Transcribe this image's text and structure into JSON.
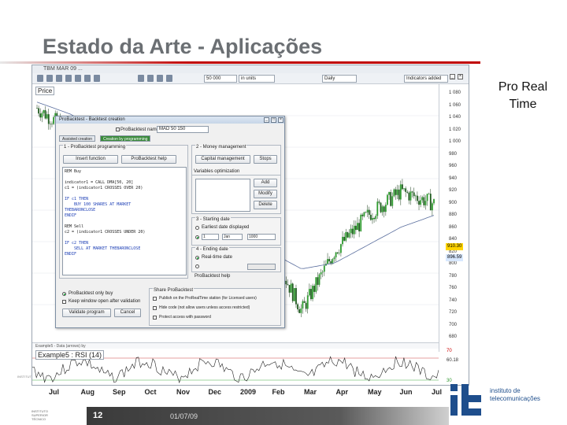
{
  "slide": {
    "title": "Estado da Arte - Aplicações",
    "side_caption_line1": "Pro Real",
    "side_caption_line2": "Time",
    "page_number": "12",
    "date": "01/07/09",
    "logo_text_line1": "instituto de",
    "logo_text_line2": "telecomunicações",
    "logo_mark": "it",
    "footer_left_lines": [
      "INSTITUTO",
      "SUPERIOR",
      "TÉCNICO"
    ],
    "instituto_small": "INSTITUT"
  },
  "app": {
    "window_title": "TBM MAR 09 ...",
    "toolbar": {
      "period_value": "50 000",
      "unit_value": "in units",
      "interval_value": "Daily",
      "indicator_value": "Indicators added"
    },
    "price_label": "Price",
    "price_ticks": [
      "1 080",
      "1 060",
      "1 040",
      "1 020",
      "1 000",
      "980",
      "960",
      "940",
      "920",
      "900",
      "880",
      "860",
      "840",
      "820",
      "800",
      "780",
      "760",
      "740",
      "720",
      "700",
      "680"
    ],
    "price_marker": "910.30",
    "price_marker2": "896.59",
    "rsi_header": "Example5 - Data (arrows) by",
    "rsi_label": "Example5 : RSI (14)",
    "rsi_ticks": [
      "70",
      "60.18",
      "30"
    ],
    "months": [
      "Jul",
      "Aug",
      "Sep",
      "Oct",
      "Nov",
      "Dec",
      "2009",
      "Feb",
      "Mar",
      "Apr",
      "May",
      "Jun",
      "Jul"
    ]
  },
  "dialog": {
    "title": "ProBacktest - Backtest creation",
    "name_label": "ProBacktest name",
    "name_value": "MAD 50 150",
    "tabs": [
      "Assisted creation",
      "Creation by programming"
    ],
    "section1_title": "1 - ProBacktest programming",
    "insert_function": "Insert function",
    "probacktest_help": "ProBacktest help",
    "code_lines": [
      {
        "text": "REM Buy",
        "kw": false
      },
      {
        "text": "",
        "kw": false
      },
      {
        "text": "indicator1 = CALL DMA[50, 20]",
        "kw": false
      },
      {
        "text": "c1 = (indicator1 CROSSES OVER 20)",
        "kw": false
      },
      {
        "text": "",
        "kw": false
      },
      {
        "text": "IF c1 THEN",
        "kw": true
      },
      {
        "text": "    BUY 100 SHARES AT MARKET",
        "kw": true
      },
      {
        "text": "THEBARONCLOSE",
        "kw": true
      },
      {
        "text": "ENDIF",
        "kw": true
      },
      {
        "text": "",
        "kw": false
      },
      {
        "text": "REM Sell",
        "kw": false
      },
      {
        "text": "c2 = (indicator1 CROSSES UNDER 20)",
        "kw": false
      },
      {
        "text": "",
        "kw": false
      },
      {
        "text": "IF c2 THEN",
        "kw": true
      },
      {
        "text": "    SELL AT MARKET THEBARONCLOSE",
        "kw": true
      },
      {
        "text": "ENDIF",
        "kw": true
      }
    ],
    "section2_title": "2 - Money management",
    "capital_management": "Capital management",
    "stops": "Stops",
    "variables_title": "Variables optimization",
    "add": "Add",
    "modify": "Modify",
    "delete": "Delete",
    "section3_title": "3 - Starting date",
    "start_option": "Earliest date displayed",
    "start_day": "1",
    "start_month": "Jan",
    "start_year": "1000",
    "section4_title": "4 - Ending date",
    "end_option": "Real-time date",
    "probacktest_help2": "ProBacktest help",
    "probuilder_option": "ProBacktest only buy",
    "alert_option": "Keep window open after validation",
    "validate": "Validate program",
    "cancel": "Cancel",
    "share_title": "Share ProBacktest",
    "share_opt1": "Publish on the ProRealTime station (for Licensed users)",
    "share_opt2": "Hide code (not allow users unless access restricted)",
    "share_opt3": "Protect access with password"
  },
  "chart_data": {
    "type": "candlestick",
    "x": [
      "Jul",
      "Aug",
      "Sep",
      "Oct",
      "Nov",
      "Dec",
      "2009",
      "Feb",
      "Mar",
      "Apr",
      "May",
      "Jun",
      "Jul"
    ],
    "series": [
      {
        "values": [
          1060,
          1020,
          1000,
          960,
          900,
          880,
          860,
          830,
          720,
          820,
          880,
          920,
          900
        ]
      },
      {
        "values": [
          1070,
          1050,
          1020,
          980,
          920,
          880,
          850,
          820,
          790,
          800,
          830,
          860,
          880
        ]
      }
    ],
    "ylim": [
      680,
      1100
    ]
  }
}
